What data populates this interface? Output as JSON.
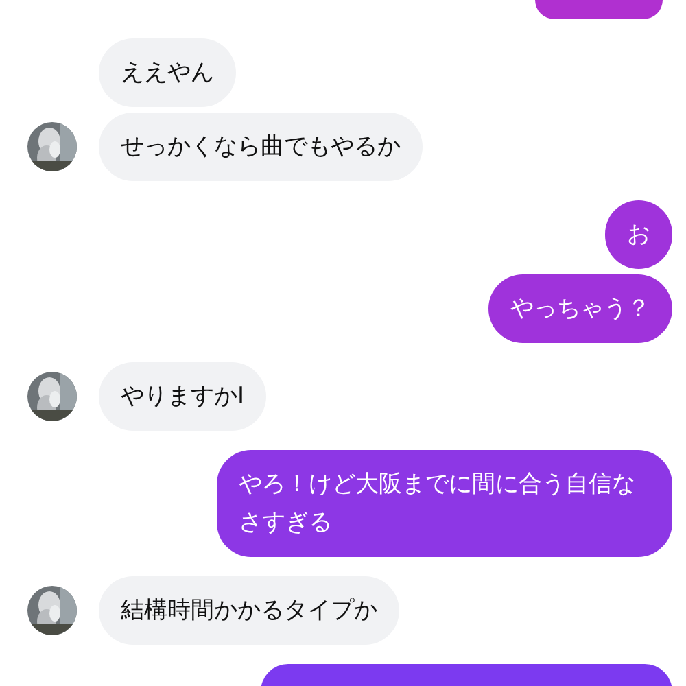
{
  "groups": [
    {
      "kind": "sent",
      "messages": [
        {
          "clipped": true
        }
      ]
    },
    {
      "kind": "received",
      "messages": [
        {
          "text": "ええやん"
        },
        {
          "text": "せっかくなら曲でもやるか"
        }
      ]
    },
    {
      "kind": "sent",
      "messages": [
        {
          "text": "お"
        },
        {
          "text": "やっちゃう？"
        }
      ]
    },
    {
      "kind": "received",
      "messages": [
        {
          "text": "やりますかI"
        }
      ]
    },
    {
      "kind": "sent",
      "messages": [
        {
          "text": "やろ！けど大阪までに間に合う自信なさすぎる"
        }
      ]
    },
    {
      "kind": "received",
      "messages": [
        {
          "text": "結構時間かかるタイプか"
        }
      ]
    },
    {
      "kind": "sent",
      "messages": [
        {
          "clipped": true
        }
      ]
    }
  ]
}
